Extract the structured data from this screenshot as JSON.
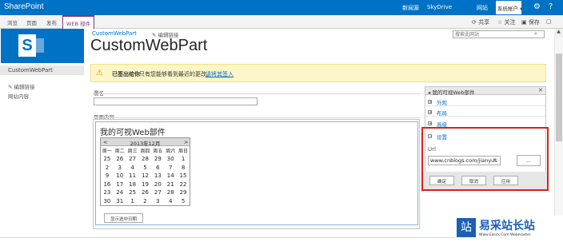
{
  "suite": {
    "brand": "SharePoint",
    "links": [
      "新闻源",
      "SkyDrive",
      "网站"
    ],
    "account": "系统帐户 ▾",
    "settings_icon": "gear-icon",
    "help_icon": "help-icon"
  },
  "ribbon": {
    "tabs": [
      "浏览",
      "页面",
      "发布",
      "WEB 部件"
    ],
    "actions": [
      "共享",
      "关注",
      "保存"
    ]
  },
  "site": {
    "breadcrumb": "CustomWebPart",
    "edit_links": "编辑链接",
    "page_title": "CustomWebPart",
    "search_placeholder": "搜索此网站"
  },
  "left_nav": {
    "current": "CustomWebPart",
    "edit_links": "编辑链接",
    "site_contents": "网站内容"
  },
  "notice": {
    "title": "已签出给你",
    "text": "只有您能够看到最近的更改。",
    "link": "请将其签入"
  },
  "form": {
    "signature_label": "署名",
    "content_label": "页面内容"
  },
  "web_part": {
    "title": "我的可视Web部件",
    "calendar": {
      "prev": "<",
      "next": ">",
      "month": "2013年12月",
      "weekdays": [
        "周一",
        "周二",
        "周三",
        "周四",
        "周五",
        "周六",
        "周日"
      ],
      "days": [
        [
          "25",
          "26",
          "27",
          "28",
          "29",
          "30",
          "1"
        ],
        [
          "2",
          "3",
          "4",
          "5",
          "6",
          "7",
          "8"
        ],
        [
          "9",
          "10",
          "11",
          "12",
          "13",
          "14",
          "15"
        ],
        [
          "16",
          "17",
          "18",
          "19",
          "20",
          "21",
          "22"
        ],
        [
          "23",
          "24",
          "25",
          "26",
          "27",
          "28",
          "29"
        ],
        [
          "30",
          "31",
          "1",
          "2",
          "3",
          "4",
          "5"
        ]
      ]
    },
    "button": "显示选中日期"
  },
  "tool_pane": {
    "title": "我的可视Web部件",
    "sections": [
      "外观",
      "布局",
      "高级",
      "设置"
    ],
    "url_label": "Url",
    "url_value": "www.cnblogs.com/jianyus",
    "url_clear": "×",
    "browse": "...",
    "ok": "确定",
    "cancel": "取消",
    "apply": "应用"
  },
  "watermark": {
    "logo": "站",
    "text": "易采站长站",
    "sub": "Www.Easck.Com Webmaster"
  }
}
